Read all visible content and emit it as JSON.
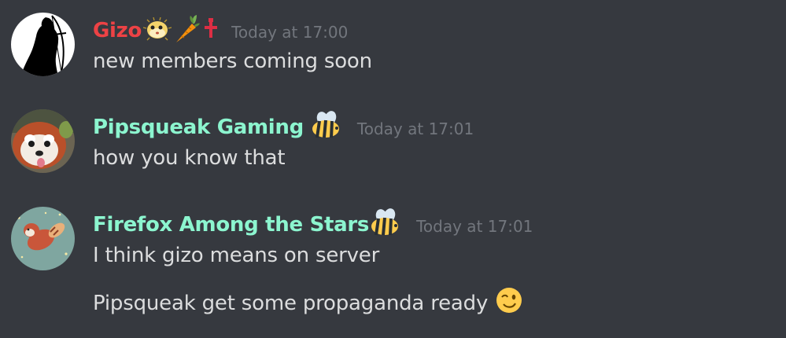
{
  "messages": [
    {
      "username": "Gizo",
      "username_color": "#ed4245",
      "username_emojis": [
        "pufferfish-emoji",
        "carrot-emoji",
        "cross-emoji"
      ],
      "timestamp": "Today at 17:00",
      "lines": [
        "new members coming soon"
      ]
    },
    {
      "username": "Pipsqueak Gaming",
      "username_color": "#8cf5cf",
      "username_emojis": [
        "bee-emoji"
      ],
      "timestamp": "Today at 17:01",
      "lines": [
        "how you know that"
      ]
    },
    {
      "username": "Firefox Among the Stars",
      "username_color": "#8cf5cf",
      "username_emojis": [
        "bee-emoji"
      ],
      "timestamp": "Today at 17:01",
      "lines": [
        "I think gizo means on server",
        "Pipsqueak get some propaganda ready"
      ],
      "trailing_emoji": "winking-face-emoji"
    }
  ],
  "colors": {
    "background": "#36393f",
    "message_text": "#dcddde",
    "timestamp": "#72767d"
  }
}
